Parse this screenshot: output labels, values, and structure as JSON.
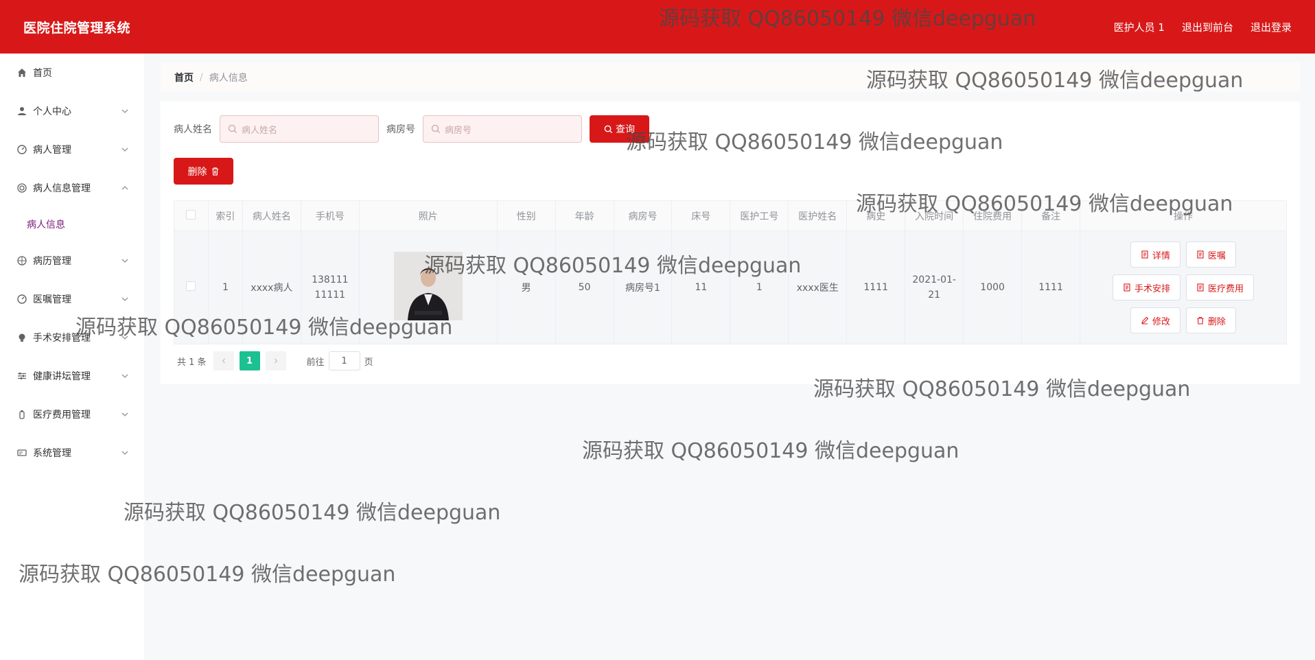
{
  "header": {
    "title": "医院住院管理系统",
    "user": "医护人员 1",
    "front_link": "退出到前台",
    "logout": "退出登录"
  },
  "sidebar": {
    "items": [
      {
        "label": "首页",
        "icon": "home-icon"
      },
      {
        "label": "个人中心",
        "icon": "user-icon"
      },
      {
        "label": "病人管理",
        "icon": "gauge-icon"
      },
      {
        "label": "病人信息管理",
        "icon": "target-icon",
        "open": true,
        "children": [
          "病人信息"
        ]
      },
      {
        "label": "病历管理",
        "icon": "aperture-icon"
      },
      {
        "label": "医嘱管理",
        "icon": "gauge-icon"
      },
      {
        "label": "手术安排管理",
        "icon": "bulb-icon"
      },
      {
        "label": "健康讲坛管理",
        "icon": "sliders-icon"
      },
      {
        "label": "医疗费用管理",
        "icon": "bottle-icon"
      },
      {
        "label": "系统管理",
        "icon": "card-icon"
      }
    ]
  },
  "breadcrumb": {
    "home": "首页",
    "sep": "/",
    "current": "病人信息"
  },
  "search": {
    "name_label": "病人姓名",
    "name_placeholder": "病人姓名",
    "room_label": "病房号",
    "room_placeholder": "病房号",
    "query_label": "查询"
  },
  "toolbar": {
    "delete_label": "删除"
  },
  "table": {
    "columns": [
      "索引",
      "病人姓名",
      "手机号",
      "照片",
      "性别",
      "年龄",
      "病房号",
      "床号",
      "医护工号",
      "医护姓名",
      "病史",
      "入院时间",
      "住院费用",
      "备注",
      "操作"
    ],
    "rows": [
      {
        "index": "1",
        "name": "xxxx病人",
        "phone": "13811111111",
        "gender": "男",
        "age": "50",
        "room": "病房号1",
        "bed": "11",
        "staff_id": "1",
        "staff_name": "xxxx医生",
        "history": "1111",
        "admit_date": "2021-01-21",
        "fee": "1000",
        "note": "1111"
      }
    ],
    "actions": [
      "详情",
      "医嘱",
      "手术安排",
      "医疗费用",
      "修改",
      "删除"
    ]
  },
  "pagination": {
    "total": "共 1 条",
    "current": "1",
    "goto_prefix": "前往",
    "goto_value": "1",
    "goto_suffix": "页"
  },
  "watermark": "源码获取 QQ86050149 微信deepguan",
  "colors": {
    "primary": "#d81818",
    "pager_active": "#1cc091"
  }
}
